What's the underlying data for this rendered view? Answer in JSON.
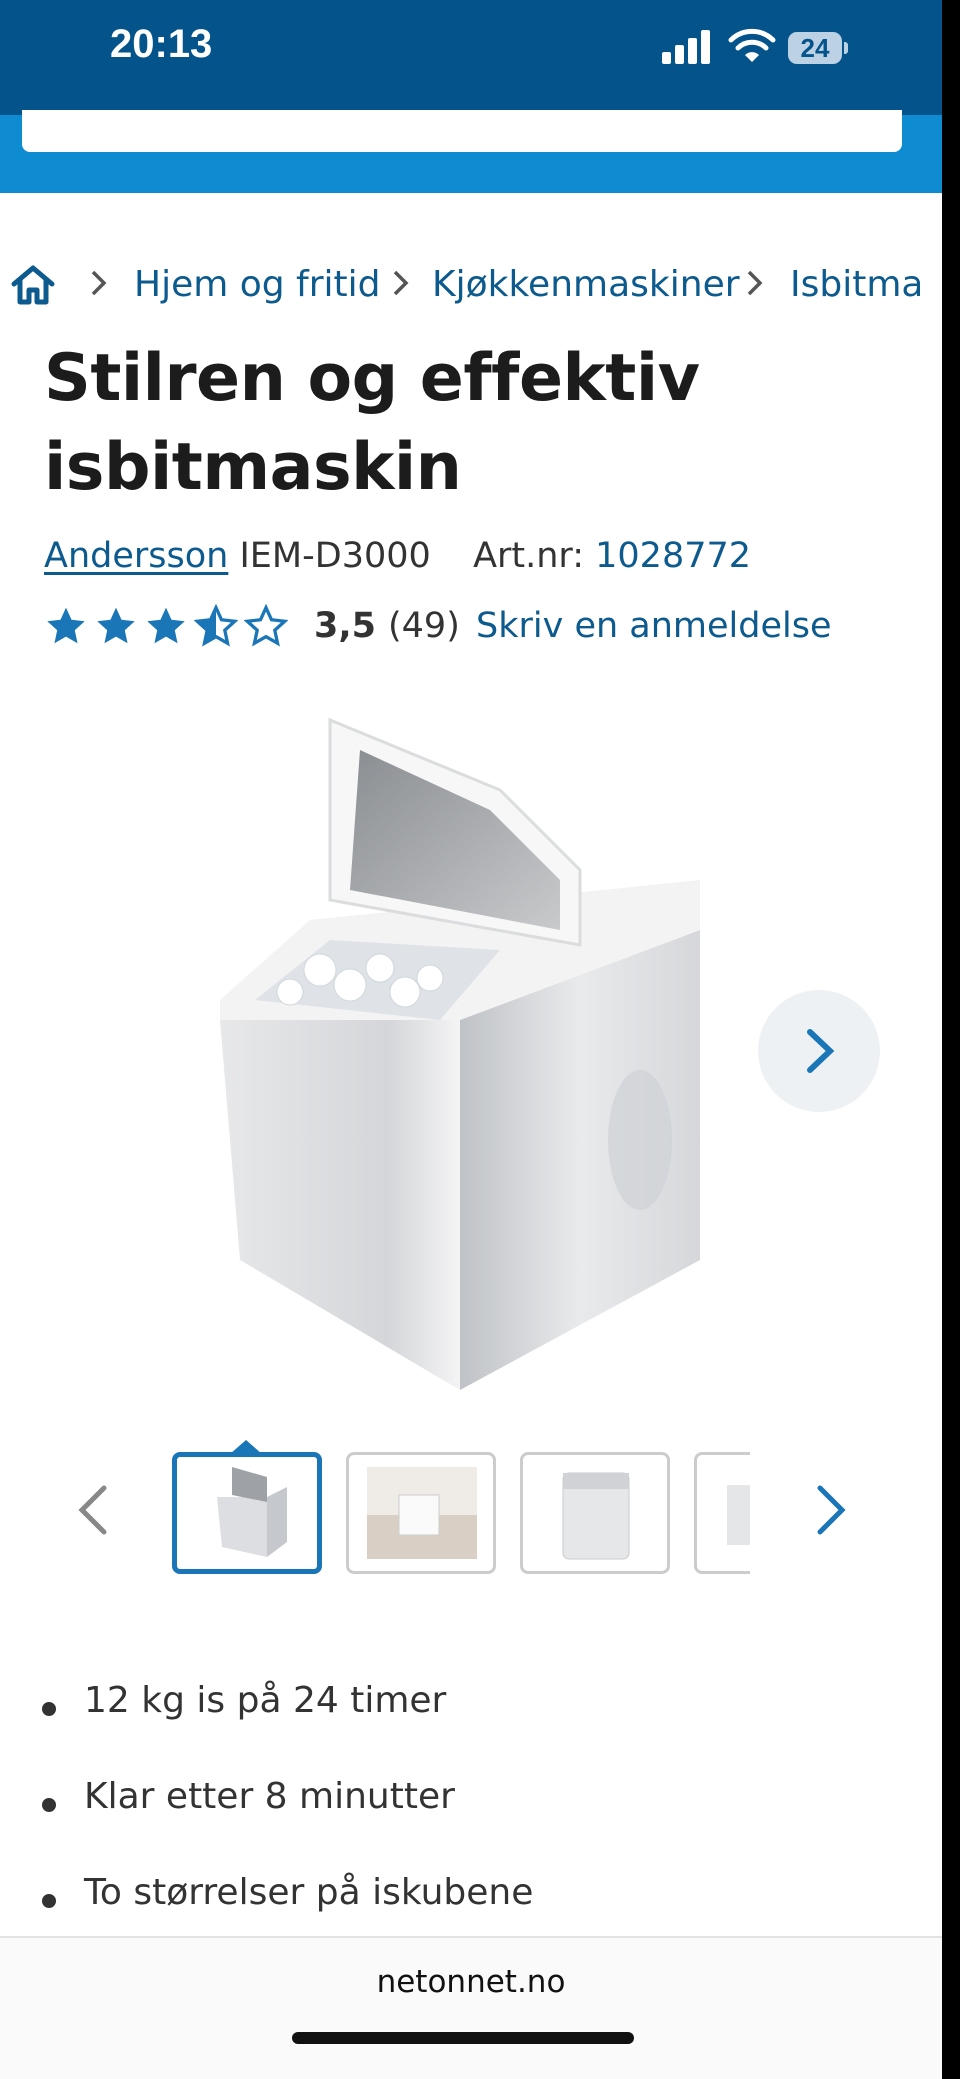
{
  "status_bar": {
    "time": "20:13",
    "battery": "24"
  },
  "breadcrumb": {
    "items": [
      "Hjem og fritid",
      "Kjøkkenmaskiner",
      "Isbitma"
    ]
  },
  "product": {
    "title_line1": "Stilren og effektiv",
    "title_line2": "isbitmaskin",
    "brand": "Andersson",
    "model": "IEM-D3000",
    "artnr_label": "Art.nr:",
    "artnr_value": "1028772",
    "rating_value": "3,5",
    "rating_stars": 3.5,
    "review_count": "(49)",
    "write_review": "Skriv en anmeldelse"
  },
  "gallery": {
    "thumbnail_count_visible": 4,
    "active_index": 0
  },
  "features": [
    "12 kg is på 24 timer",
    "Klar etter 8 minutter",
    "To størrelser på iskubene"
  ],
  "browser": {
    "url": "netonnet.no"
  },
  "colors": {
    "brand_dark": "#04538a",
    "brand_light": "#0f8bd2",
    "link": "#0c5a8e",
    "star": "#1a76b7"
  }
}
